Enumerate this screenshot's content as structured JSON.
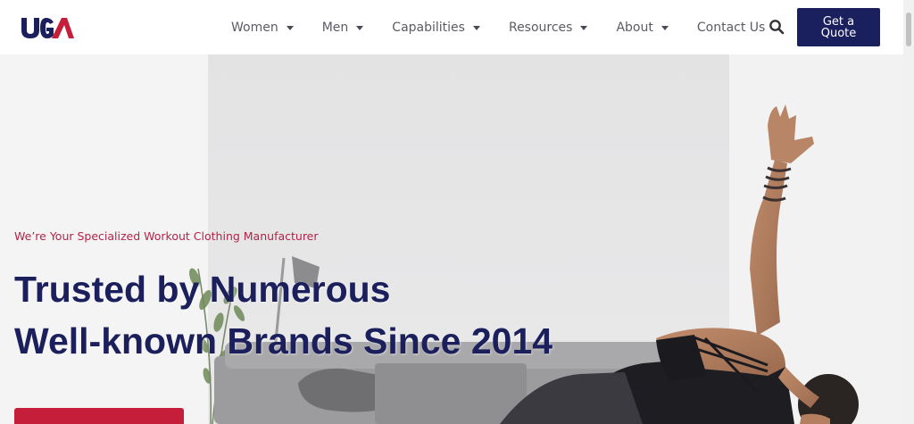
{
  "header": {
    "logo_text": "UGA",
    "nav": [
      {
        "label": "Women",
        "has_dropdown": true
      },
      {
        "label": "Men",
        "has_dropdown": true
      },
      {
        "label": "Capabilities",
        "has_dropdown": true
      },
      {
        "label": "Resources",
        "has_dropdown": true
      },
      {
        "label": "About",
        "has_dropdown": true
      },
      {
        "label": "Contact Us",
        "has_dropdown": false
      }
    ],
    "search_icon": "search-icon",
    "quote_button": "Get a Quote"
  },
  "hero": {
    "subtitle": "We’re Your Specialized Workout Clothing Manufacturer",
    "headline_line1": "Trusted by Numerous",
    "headline_line2": "Well-known Brands Since 2014",
    "cta_label": ""
  },
  "colors": {
    "brand_navy": "#1a1f5e",
    "brand_red": "#c41e3a",
    "subtitle_red": "#b3234a"
  }
}
